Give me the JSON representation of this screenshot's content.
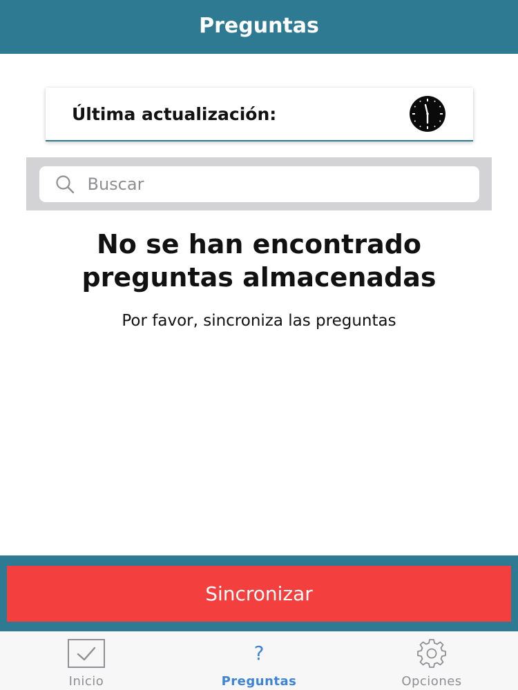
{
  "header": {
    "title": "Preguntas"
  },
  "update_card": {
    "label": "Última actualización:",
    "icon": "clock-icon"
  },
  "search": {
    "placeholder": "Buscar",
    "value": "",
    "icon": "search-icon"
  },
  "empty_state": {
    "title": "No se han encontrado preguntas almacenadas",
    "subtitle": "Por favor, sincroniza las preguntas"
  },
  "sync": {
    "label": "Sincronizar"
  },
  "tabs": [
    {
      "label": "Inicio",
      "icon": "checkbox-icon",
      "active": false
    },
    {
      "label": "Preguntas",
      "icon": "question-icon",
      "active": true,
      "glyph": "?"
    },
    {
      "label": "Opciones",
      "icon": "gear-icon",
      "active": false
    }
  ],
  "colors": {
    "header": "#2e7a93",
    "sync_button": "#f43f3f",
    "active_tab": "#3e84d6",
    "inactive_tab": "#8e8e93"
  }
}
